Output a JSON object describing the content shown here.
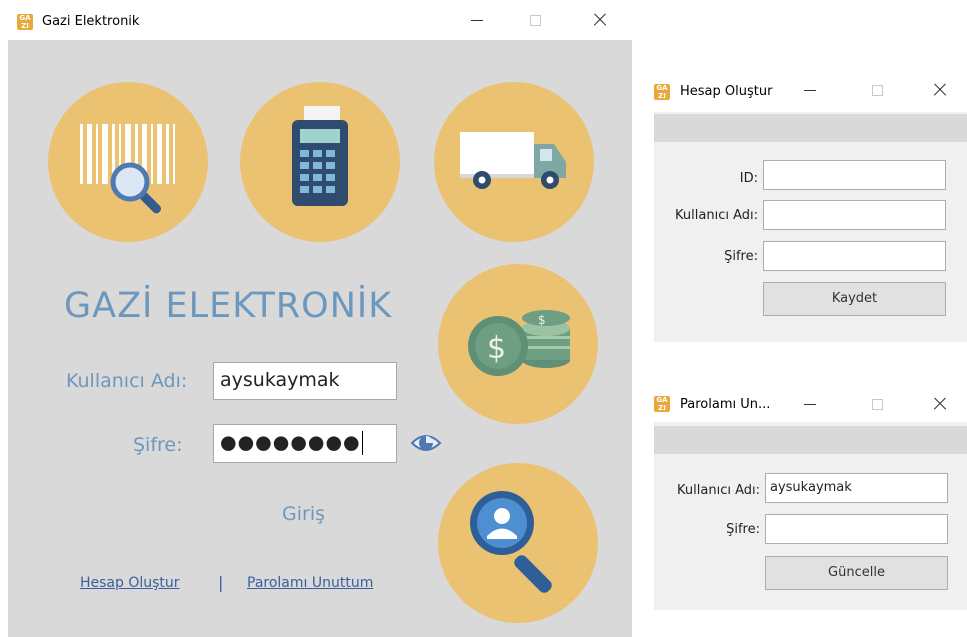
{
  "main_window": {
    "title": "Gazi Elektronik",
    "icon_text": "GA ZI",
    "brand_title": "GAZİ ELEKTRONİK",
    "username_label": "Kullanıcı Adı:",
    "username_value": "aysukaymak",
    "password_label": "Şifre:",
    "password_mask": "●●●●●●●●",
    "login_label": "Giriş",
    "create_account_link": "Hesap Oluştur",
    "separator": "|",
    "forgot_password_link": "Parolamı Unuttum",
    "feature_icons": [
      "barcode-search-icon",
      "calculator-icon",
      "delivery-truck-icon",
      "money-coins-icon",
      "user-search-icon"
    ]
  },
  "create_account_window": {
    "title": "Hesap Oluştur",
    "id_label": "ID:",
    "id_value": "",
    "username_label": "Kullanıcı Adı:",
    "username_value": "",
    "password_label": "Şifre:",
    "password_value": "",
    "save_label": "Kaydet"
  },
  "forgot_password_window": {
    "title": "Parolamı Un...",
    "username_label": "Kullanıcı Adı:",
    "username_value": "aysukaymak",
    "password_label": "Şifre:",
    "password_value": "",
    "update_label": "Güncelle"
  },
  "colors": {
    "circle_fill": "#eac271",
    "text_blue": "#6e97be",
    "client_gray": "#d9d9d9"
  }
}
